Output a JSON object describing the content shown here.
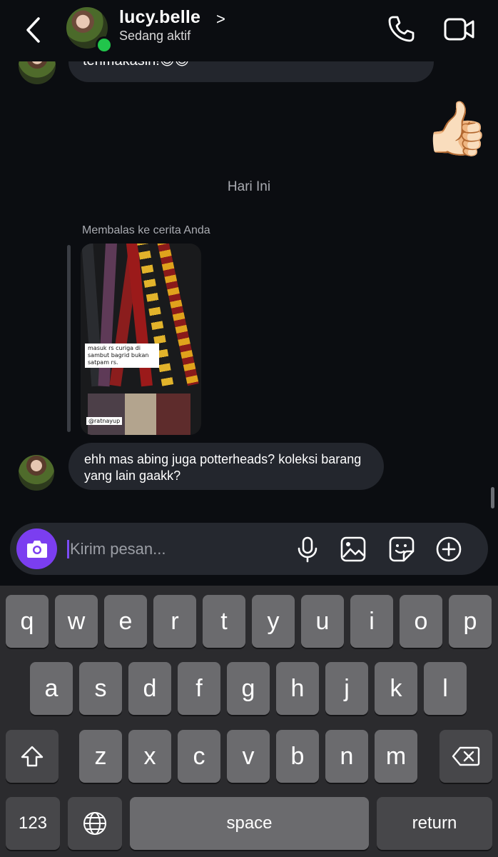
{
  "header": {
    "username": "lucy.belle",
    "chevron": ">",
    "status": "Sedang aktif"
  },
  "thread": {
    "partial_message": "terimakasih!😊😊",
    "sent_emoji": "👍🏻",
    "date_separator": "Hari Ini",
    "reply_label": "Membalas ke cerita Anda",
    "story": {
      "caption": "masuk rs curiga di sambut bagrid bukan satpam rs.",
      "tag": "@ratnayup"
    },
    "last_message": "ehh mas abing juga potterheads? koleksi barang yang lain gaakk?"
  },
  "composer": {
    "placeholder": "Kirim pesan..."
  },
  "keyboard": {
    "row1": [
      "q",
      "w",
      "e",
      "r",
      "t",
      "y",
      "u",
      "i",
      "o",
      "p"
    ],
    "row2": [
      "a",
      "s",
      "d",
      "f",
      "g",
      "h",
      "j",
      "k",
      "l"
    ],
    "row3": [
      "z",
      "x",
      "c",
      "v",
      "b",
      "n",
      "m"
    ],
    "numbers": "123",
    "space": "space",
    "return": "return"
  },
  "colors": {
    "background": "#0b0d11",
    "bubble": "#23262d",
    "accent": "#7b3ef0",
    "online": "#21c54b"
  }
}
